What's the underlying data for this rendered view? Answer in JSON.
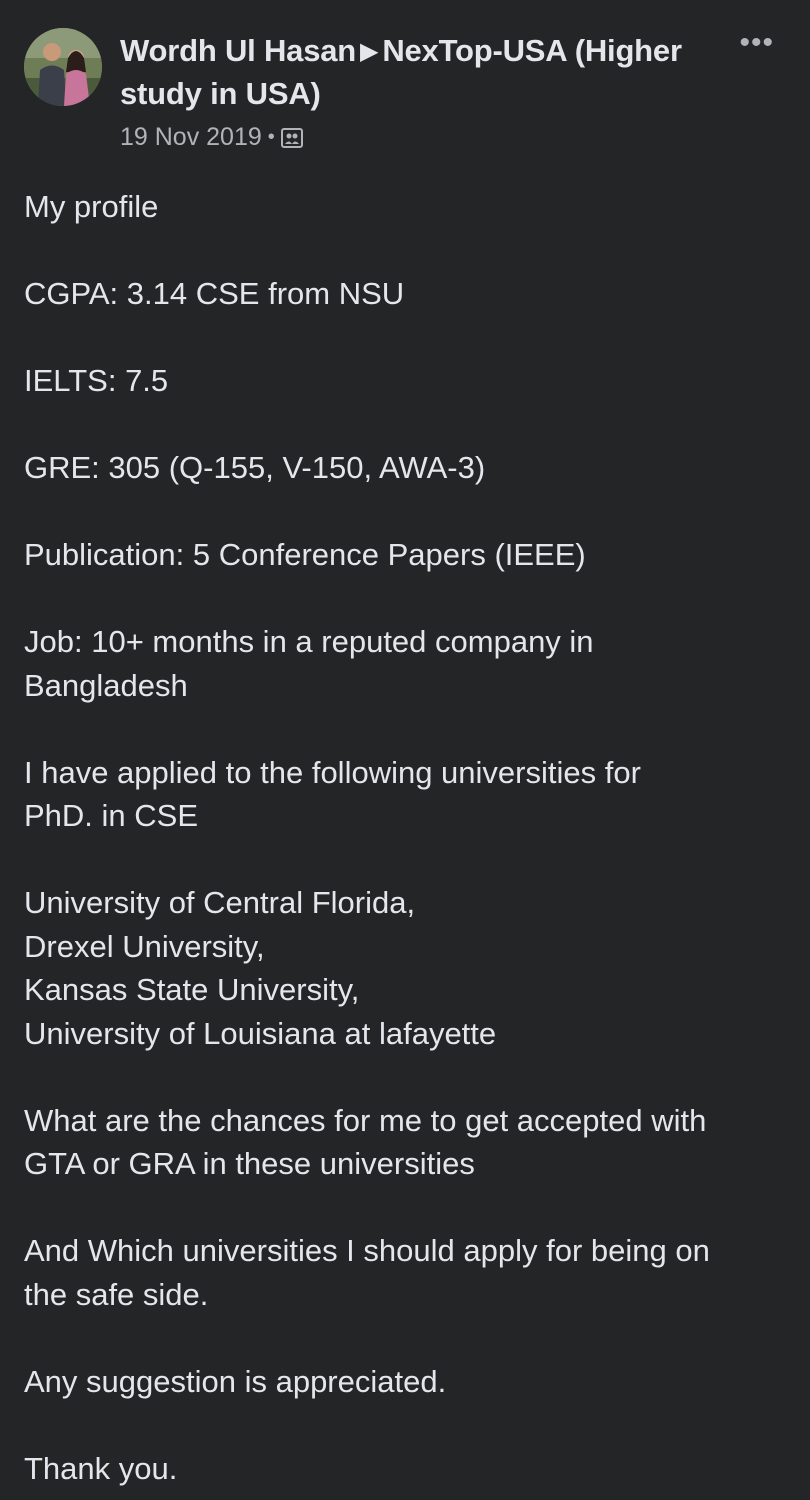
{
  "post": {
    "author": "Wordh Ul Hasan",
    "group": "NexTop-USA (Higher study in USA)",
    "arrow_glyph": "▶",
    "date": "19 Nov 2019",
    "separator": "•",
    "audience_icon": "group-icon",
    "more_glyph": "•••",
    "paragraphs": [
      {
        "lines": [
          "My profile"
        ]
      },
      {
        "lines": [
          "CGPA: 3.14 CSE from NSU"
        ]
      },
      {
        "lines": [
          "IELTS: 7.5"
        ]
      },
      {
        "lines": [
          "GRE: 305 (Q-155, V-150, AWA-3)"
        ]
      },
      {
        "lines": [
          "Publication: 5 Conference Papers (IEEE)"
        ]
      },
      {
        "lines": [
          "Job: 10+ months in a reputed company in",
          "Bangladesh"
        ]
      },
      {
        "lines": [
          "I have applied to the following universities for",
          "PhD. in CSE"
        ]
      },
      {
        "lines": [
          "University of Central Florida,",
          "Drexel University,",
          "Kansas State University,",
          "University of Louisiana at lafayette"
        ]
      },
      {
        "lines": [
          "What are the chances for me to get accepted with",
          "GTA or GRA in these universities"
        ]
      },
      {
        "lines": [
          "And Which universities I should apply for being on",
          "the safe side."
        ]
      },
      {
        "lines": [
          "Any suggestion is appreciated."
        ]
      },
      {
        "lines": [
          "Thank you."
        ]
      }
    ]
  },
  "colors": {
    "background": "#242526",
    "primary_text": "#e4e6eb",
    "secondary_text": "#b0b3b8"
  }
}
